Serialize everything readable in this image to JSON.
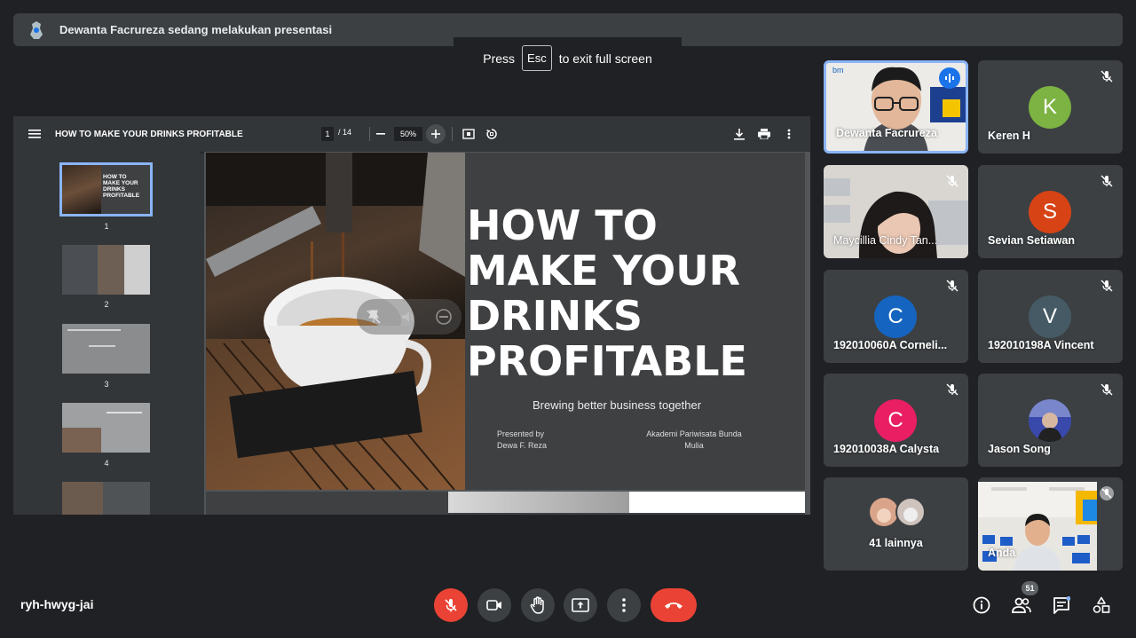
{
  "banner": {
    "presenter_text": "Dewanta Facrureza sedang melakukan presentasi"
  },
  "esc_toast": {
    "press": "Press",
    "key": "Esc",
    "suffix": "to exit full screen"
  },
  "pdf": {
    "title": "HOW TO MAKE YOUR DRINKS PROFITABLE",
    "current_page": "1",
    "total_pages": "/ 14",
    "zoom": "50%",
    "thumbnails": [
      {
        "num": "1",
        "active": true
      },
      {
        "num": "2"
      },
      {
        "num": "3"
      },
      {
        "num": "4"
      }
    ]
  },
  "slide": {
    "title_lines": [
      "HOW TO",
      "MAKE YOUR",
      "DRINKS",
      "PROFITABLE"
    ],
    "subtitle": "Brewing better business together",
    "presented_by_label": "Presented by",
    "presenter": "Dewa F. Reza",
    "institution_line1": "Akademi Pariwisata Bunda",
    "institution_line2": "Mulia"
  },
  "participants": [
    {
      "name": "Dewanta Facrureza",
      "type": "video",
      "speaking": true
    },
    {
      "name": "Keren H",
      "initial": "K",
      "color": "#7cb342",
      "muted": true
    },
    {
      "name": "Maycillia Cindy Tan...",
      "type": "video",
      "muted": true
    },
    {
      "name": "Sevian Setiawan",
      "initial": "S",
      "color": "#d84315",
      "muted": true
    },
    {
      "name": "192010060A Corneli...",
      "initial": "C",
      "color": "#1565c0",
      "muted": true
    },
    {
      "name": "192010198A Vincent",
      "initial": "V",
      "color": "#455a64",
      "muted": true
    },
    {
      "name": "192010038A Calysta",
      "initial": "C",
      "color": "#e91e63",
      "muted": true
    },
    {
      "name": "Jason Song",
      "type": "photo",
      "muted": true
    },
    {
      "name": "41 lainnya",
      "type": "others"
    },
    {
      "name": "Anda",
      "type": "video",
      "muted": true
    }
  ],
  "bottom": {
    "meeting_code": "ryh-hwyg-jai",
    "participant_count": "51"
  },
  "colors": {
    "hangup": "#ea4335",
    "accent": "#8ab4f8",
    "bg": "#202124",
    "tile": "#3c4043"
  }
}
